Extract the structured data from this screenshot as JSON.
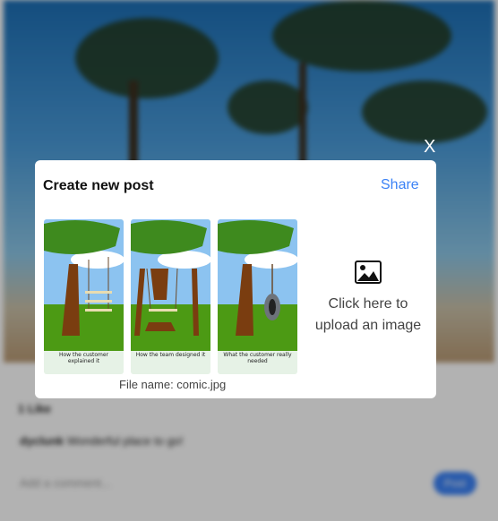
{
  "background": {
    "likes": "1 Like",
    "caption_user": "dyclunk",
    "caption_text": "Wonderful place to go!",
    "comment_placeholder": "Add a comment...",
    "post_button": "Post"
  },
  "modal": {
    "close_label": "X",
    "title": "Create new post",
    "share_label": "Share",
    "panels": [
      {
        "caption": "How the customer explained it"
      },
      {
        "caption": "How the team designed it"
      },
      {
        "caption": "What the customer really needed"
      }
    ],
    "file_name": "File name: comic.jpg",
    "upload_line1": "Click here to",
    "upload_line2": "upload an image",
    "icon": "image-icon"
  }
}
